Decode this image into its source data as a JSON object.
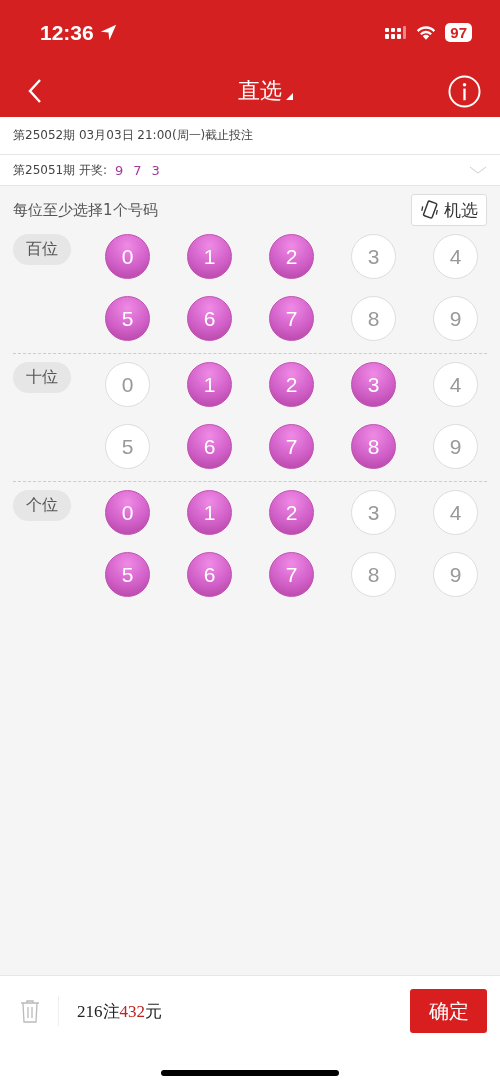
{
  "status_bar": {
    "time": "12:36",
    "battery": "97"
  },
  "nav": {
    "title": "直选"
  },
  "deadline": "第25052期 03月03日 21:00(周一)截止投注",
  "last_draw": {
    "label": "第25051期 开奖:",
    "numbers": [
      "9",
      "7",
      "3"
    ]
  },
  "hint": "每位至少选择1个号码",
  "random_button": "机选",
  "positions": [
    {
      "label": "百位",
      "balls": [
        {
          "number": "0",
          "selected": true
        },
        {
          "number": "1",
          "selected": true
        },
        {
          "number": "2",
          "selected": true
        },
        {
          "number": "3",
          "selected": false
        },
        {
          "number": "4",
          "selected": false
        },
        {
          "number": "5",
          "selected": true
        },
        {
          "number": "6",
          "selected": true
        },
        {
          "number": "7",
          "selected": true
        },
        {
          "number": "8",
          "selected": false
        },
        {
          "number": "9",
          "selected": false
        }
      ]
    },
    {
      "label": "十位",
      "balls": [
        {
          "number": "0",
          "selected": false
        },
        {
          "number": "1",
          "selected": true
        },
        {
          "number": "2",
          "selected": true
        },
        {
          "number": "3",
          "selected": true
        },
        {
          "number": "4",
          "selected": false
        },
        {
          "number": "5",
          "selected": false
        },
        {
          "number": "6",
          "selected": true
        },
        {
          "number": "7",
          "selected": true
        },
        {
          "number": "8",
          "selected": true
        },
        {
          "number": "9",
          "selected": false
        }
      ]
    },
    {
      "label": "个位",
      "balls": [
        {
          "number": "0",
          "selected": true
        },
        {
          "number": "1",
          "selected": true
        },
        {
          "number": "2",
          "selected": true
        },
        {
          "number": "3",
          "selected": false
        },
        {
          "number": "4",
          "selected": false
        },
        {
          "number": "5",
          "selected": true
        },
        {
          "number": "6",
          "selected": true
        },
        {
          "number": "7",
          "selected": true
        },
        {
          "number": "8",
          "selected": false
        },
        {
          "number": "9",
          "selected": false
        }
      ]
    }
  ],
  "footer": {
    "bets": "216注",
    "amount": "432",
    "unit": "元",
    "confirm": "确定"
  }
}
